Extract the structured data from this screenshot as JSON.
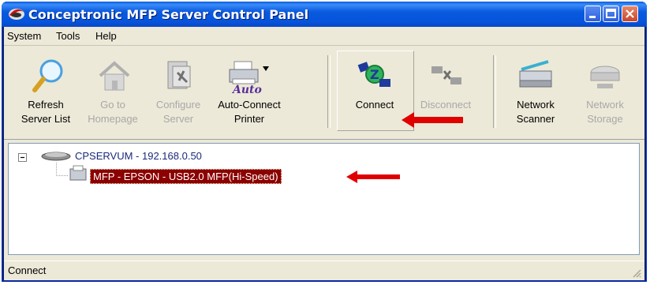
{
  "window": {
    "title": "Conceptronic MFP Server Control Panel"
  },
  "menu": [
    "System",
    "Tools",
    "Help"
  ],
  "toolbar": {
    "refresh": "Refresh\nServer List",
    "goto": "Go to\nHomepage",
    "configure": "Configure\nServer",
    "autoconnect": "Auto-Connect\nPrinter",
    "auto_badge": "Auto",
    "connect": "Connect",
    "disconnect": "Disconnect",
    "scanner": "Network\nScanner",
    "storage": "Network\nStorage"
  },
  "tree": {
    "server": "CPSERVUM - 192.168.0.50",
    "printer": "MFP - EPSON - USB2.0 MFP(Hi-Speed)"
  },
  "status": {
    "text": "Connect"
  },
  "colors": {
    "arrow": "#e00000",
    "selection": "#8b0000",
    "titlebar": "#0a5ae0"
  }
}
